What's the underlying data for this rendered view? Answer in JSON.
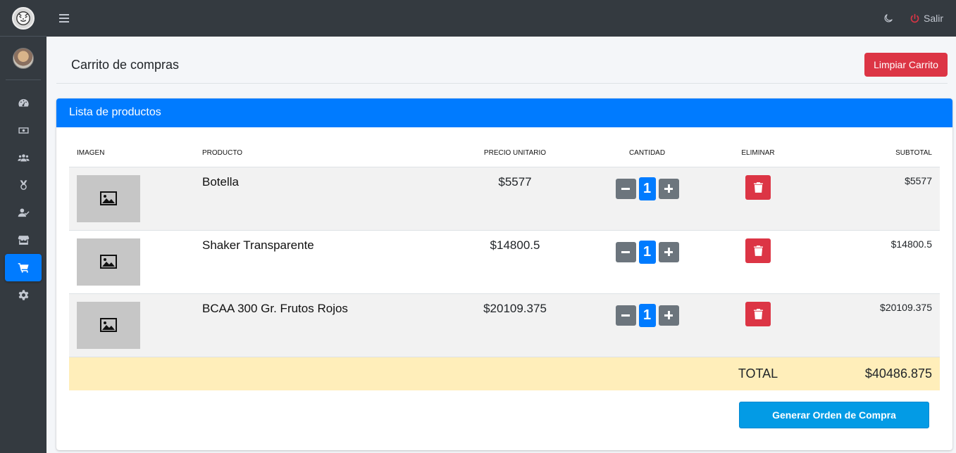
{
  "topbar": {
    "logout_label": "Salir"
  },
  "header": {
    "title": "Carrito de compras",
    "clear_button": "Limpiar Carrito"
  },
  "card": {
    "title": "Lista de productos",
    "columns": {
      "image": "IMAGEN",
      "product": "PRODUCTO",
      "unit_price": "PRECIO UNITARIO",
      "quantity": "CANTIDAD",
      "delete": "ELIMINAR",
      "subtotal": "SUBTOTAL"
    },
    "items": [
      {
        "name": "Botella",
        "price": "$5577",
        "qty": "1",
        "subtotal": "$5577"
      },
      {
        "name": "Shaker Transparente",
        "price": "$14800.5",
        "qty": "1",
        "subtotal": "$14800.5"
      },
      {
        "name": "BCAA 300 Gr. Frutos Rojos",
        "price": "$20109.375",
        "qty": "1",
        "subtotal": "$20109.375"
      }
    ],
    "total_label": "TOTAL",
    "total_value": "$40486.875",
    "order_button": "Generar Orden de Compra"
  },
  "sidebar": {
    "items": [
      {
        "icon": "dashboard-icon"
      },
      {
        "icon": "money-icon"
      },
      {
        "icon": "users-icon"
      },
      {
        "icon": "medal-icon"
      },
      {
        "icon": "user-check-icon"
      },
      {
        "icon": "store-icon"
      },
      {
        "icon": "cart-icon",
        "active": true
      },
      {
        "icon": "gear-icon"
      }
    ]
  },
  "colors": {
    "primary": "#007bff",
    "danger": "#dc3545",
    "secondary": "#6c757d",
    "sidebar": "#343a40",
    "total_row": "#ffeeba",
    "order_button": "#039be5"
  }
}
